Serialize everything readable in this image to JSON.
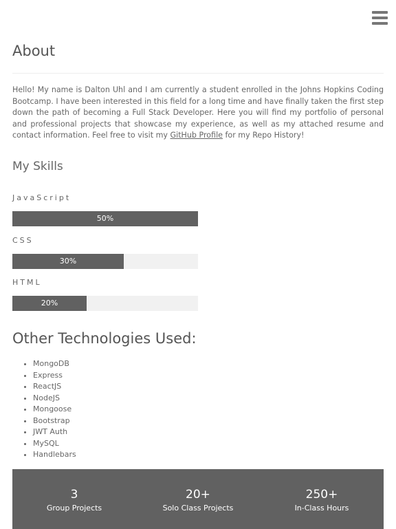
{
  "menu": {
    "icon": "hamburger-menu-icon"
  },
  "about": {
    "title": "About",
    "text_before_link": "Hello! My name is Dalton Uhl and I am currently a student enrolled in the Johns Hopkins Coding Bootcamp. I have been interested in this field for a long time and have finally taken the first step down the path of becoming a Full Stack Developer. Here you will find my portfolio of personal and professional projects that showcase my experience, as well as my attached resume and contact information. Feel free to visit my ",
    "link_text": "GitHub Profile",
    "text_after_link": " for my Repo History!"
  },
  "skills": {
    "title": "My Skills",
    "items": [
      {
        "label": "JavaScript",
        "percent_label": "50%",
        "fill_fraction": 1.0
      },
      {
        "label": "CSS",
        "percent_label": "30%",
        "fill_fraction": 0.6
      },
      {
        "label": "HTML",
        "percent_label": "20%",
        "fill_fraction": 0.4
      }
    ]
  },
  "technologies": {
    "title": "Other Technologies Used:",
    "items": [
      "MongoDB",
      "Express",
      "ReactJS",
      "NodeJS",
      "Mongoose",
      "Bootstrap",
      "JWT Auth",
      "MySQL",
      "Handlebars"
    ]
  },
  "stats": [
    {
      "value": "3",
      "label": "Group Projects"
    },
    {
      "value": "20+",
      "label": "Solo Class Projects"
    },
    {
      "value": "250+",
      "label": "In-Class Hours"
    }
  ],
  "colors": {
    "bar_fill": "#616161",
    "bar_track": "#f1f1f1",
    "stats_bg": "#616161"
  }
}
